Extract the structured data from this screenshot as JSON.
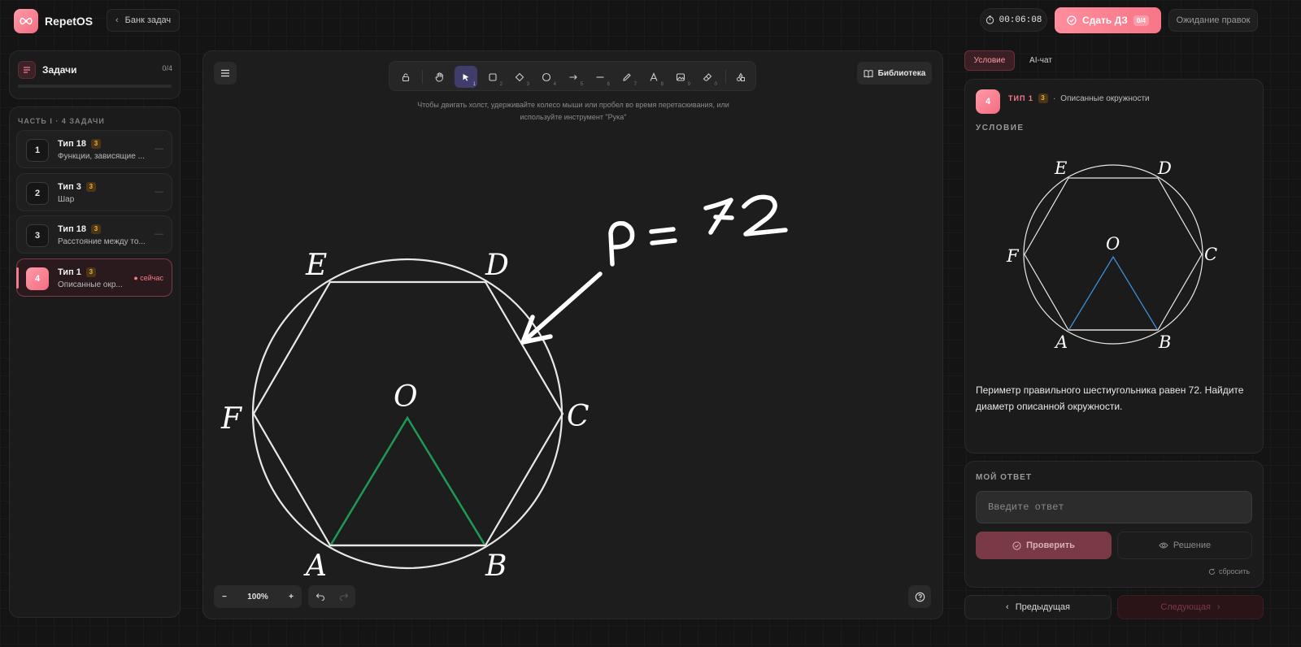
{
  "app": {
    "name": "RepetOS",
    "back_label": "Банк задач"
  },
  "header": {
    "timer": "00:06:08",
    "submit_label": "Сдать ДЗ",
    "submit_badge": "0/4",
    "await_label": "Ожидание правок"
  },
  "sidebar": {
    "title": "Задачи",
    "count": "0/4",
    "part_label": "ЧАСТЬ I · 4 ЗАДАЧИ",
    "tasks": [
      {
        "num": "1",
        "type": "Тип 18",
        "level": "3",
        "desc": "Функции, зависящие ...",
        "state": "—"
      },
      {
        "num": "2",
        "type": "Тип 3",
        "level": "3",
        "desc": "Шар",
        "state": "—"
      },
      {
        "num": "3",
        "type": "Тип 18",
        "level": "3",
        "desc": "Расстояние между то...",
        "state": "—"
      },
      {
        "num": "4",
        "type": "Тип 1",
        "level": "3",
        "desc": "Описанные окр...",
        "state": "● сейчас"
      }
    ]
  },
  "canvas": {
    "library_label": "Библиотека",
    "hint": "Чтобы двигать холст, удерживайте колесо мыши или пробел во время перетаскивания, или используйте инструмент \"Рука\"",
    "zoom": "100%",
    "tools": [
      {
        "icon": "lock-icon",
        "key": ""
      },
      {
        "icon": "hand-icon",
        "key": ""
      },
      {
        "icon": "cursor-icon",
        "key": "1",
        "selected": true
      },
      {
        "icon": "rectangle-icon",
        "key": "2"
      },
      {
        "icon": "diamond-icon",
        "key": "3"
      },
      {
        "icon": "circle-icon",
        "key": "4"
      },
      {
        "icon": "arrow-icon",
        "key": "5"
      },
      {
        "icon": "line-icon",
        "key": "6"
      },
      {
        "icon": "pencil-icon",
        "key": "7"
      },
      {
        "icon": "text-icon",
        "key": "8"
      },
      {
        "icon": "image-icon",
        "key": "9"
      },
      {
        "icon": "eraser-icon",
        "key": "0"
      },
      {
        "icon": "shapes-icon",
        "key": ""
      }
    ],
    "figure_labels": {
      "E": "E",
      "D": "D",
      "F": "F",
      "C": "C",
      "O": "O",
      "A": "A",
      "B": "B"
    },
    "handwritten_note": "P = 72",
    "colors": {
      "triangle": "#1e9a55",
      "shape": "#e8e8e8"
    }
  },
  "right_panel": {
    "tab_condition": "Условие",
    "tab_chat": "AI-чат",
    "task_num": "4",
    "task_type": "ТИП 1",
    "task_level": "3",
    "task_sep": "·",
    "task_topic": "Описанные окружности",
    "condition_label": "УСЛОВИЕ",
    "figure_labels": {
      "E": "E",
      "D": "D",
      "F": "F",
      "C": "C",
      "O": "O",
      "A": "A",
      "B": "B"
    },
    "condition_text": "Периметр правильного шестиугольника равен 72. Найдите диаметр описанной окружности.",
    "answer_label": "МОЙ ОТВЕТ",
    "answer_placeholder": "Введите ответ",
    "answer_value": "",
    "check_label": "Проверить",
    "solution_label": "Решение",
    "reset_label": "сбросить",
    "prev_label": "Предыдущая",
    "next_label": "Следующая",
    "colors": {
      "triangle": "#3d8fd6",
      "accent": "#f47c8d"
    }
  }
}
